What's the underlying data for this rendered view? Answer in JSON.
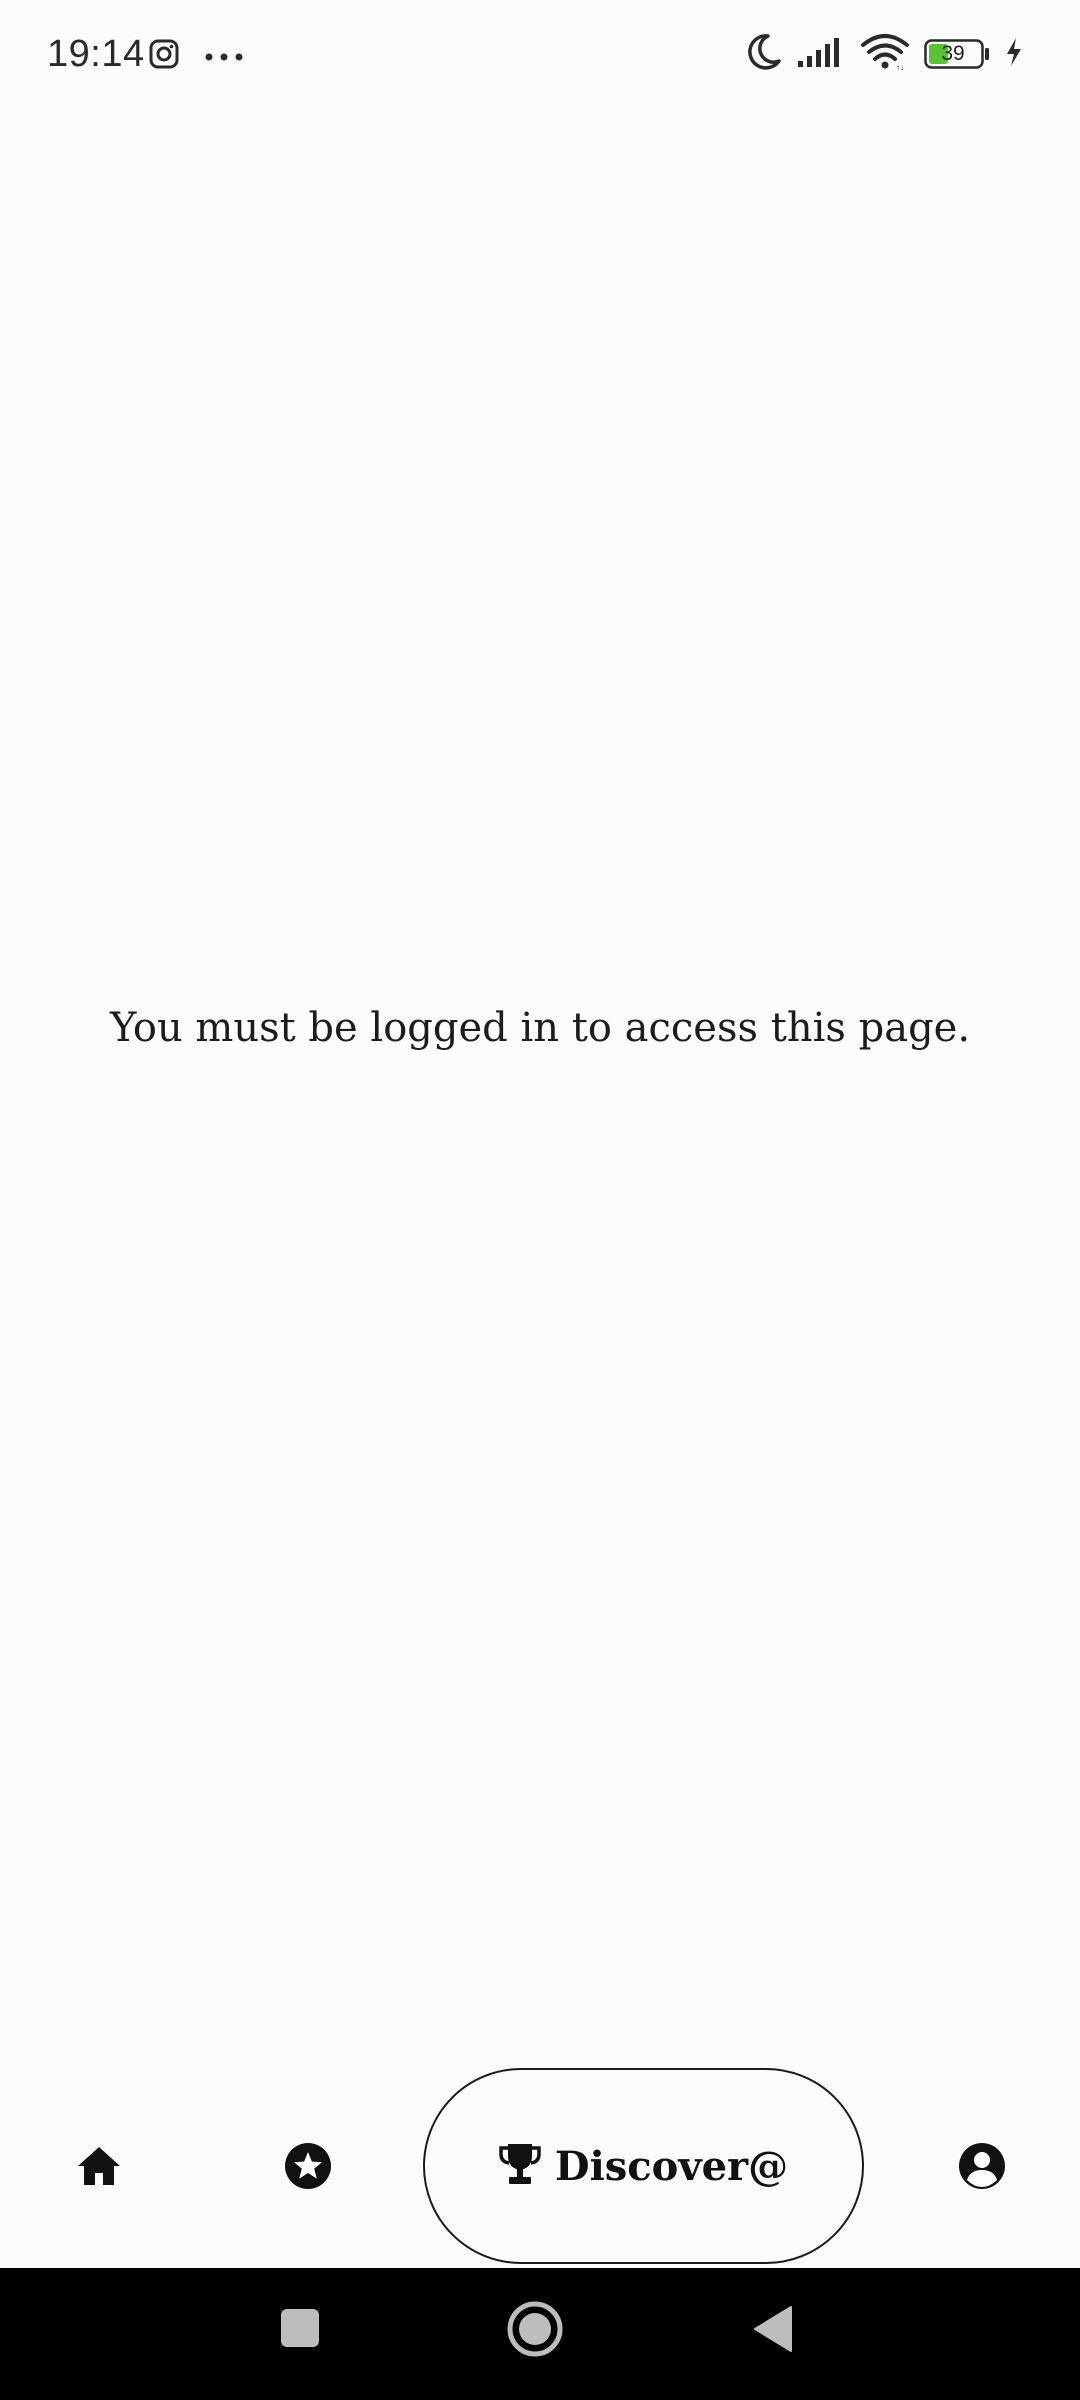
{
  "status_bar": {
    "time": "19:14",
    "battery_level": "39",
    "icons": [
      "instagram-icon",
      "more-dots-icon",
      "do-not-disturb-moon-icon",
      "cellular-signal-icon",
      "wifi-icon",
      "battery-icon",
      "charging-bolt-icon"
    ]
  },
  "main": {
    "message": "You must be logged in to access this page."
  },
  "bottom_nav": {
    "items": [
      {
        "icon": "home-icon"
      },
      {
        "icon": "star-circle-icon"
      },
      {
        "icon": "trophy-icon",
        "label": "Discover@",
        "selected": true
      },
      {
        "icon": "user-circle-icon"
      }
    ]
  },
  "system_nav": {
    "buttons": [
      "recents-square-icon",
      "home-circle-icon",
      "back-triangle-icon"
    ]
  },
  "colors": {
    "background": "#fbfdfd",
    "text": "#1c1c1c",
    "battery_fill": "#5bc236",
    "system_nav_bg": "#000000"
  }
}
